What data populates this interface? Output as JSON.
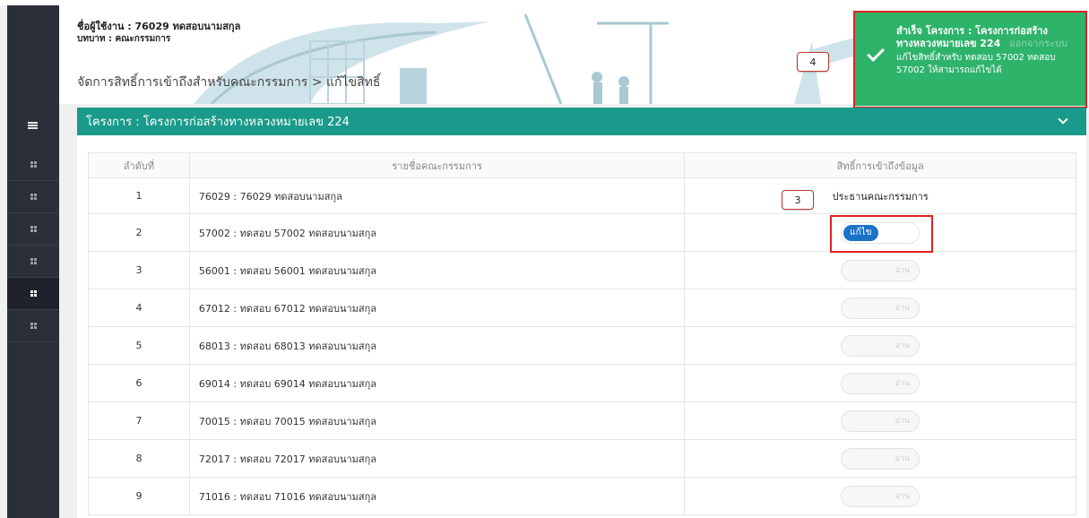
{
  "header": {
    "user_line": "ชื่อผู้ใช้งาน : 76029 ทดสอบนามสกุล",
    "role_line": "บทบาท : คณะกรรมการ",
    "breadcrumb": "จัดการสิทธิ์การเข้าถึงสำหรับคณะกรรมการ > แก้ไขสิทธิ์",
    "logout_label": "ออกจากระบบ"
  },
  "toast": {
    "title": "สำเร็จ โครงการ : โครงการก่อสร้างทางหลวงหมายเลข 224",
    "body": "แก้ไขสิทธิ์สำหรับ ทดสอบ 57002 ทดสอบ 57002 ให้สามารถแก้ไขได้",
    "color": "#2eb36b"
  },
  "callouts": {
    "toast": "4",
    "toggle": "3"
  },
  "panel": {
    "title": "โครงการ : โครงการก่อสร้างทางหลวงหมายเลข 224",
    "color": "#1a9a8a"
  },
  "table": {
    "headers": [
      "ลำดับที่",
      "รายชื่อคณะกรรมการ",
      "สิทธิ์การเข้าถึงข้อมูล"
    ],
    "rows": [
      {
        "idx": "1",
        "name": "76029 : 76029 ทดสอบนามสกุล",
        "role": "ประธานคณะกรรมการ"
      },
      {
        "idx": "2",
        "name": "57002 : ทดสอบ 57002 ทดสอบนามสกุล",
        "toggle": "แก้ไข",
        "state": "on"
      },
      {
        "idx": "3",
        "name": "56001 : ทดสอบ 56001 ทดสอบนามสกุล",
        "toggle": "อ่าน",
        "state": "off"
      },
      {
        "idx": "4",
        "name": "67012 : ทดสอบ 67012 ทดสอบนามสกุล",
        "toggle": "อ่าน",
        "state": "off"
      },
      {
        "idx": "5",
        "name": "68013 : ทดสอบ 68013 ทดสอบนามสกุล",
        "toggle": "อ่าน",
        "state": "off"
      },
      {
        "idx": "6",
        "name": "69014 : ทดสอบ 69014 ทดสอบนามสกุล",
        "toggle": "อ่าน",
        "state": "off"
      },
      {
        "idx": "7",
        "name": "70015 : ทดสอบ 70015 ทดสอบนามสกุล",
        "toggle": "อ่าน",
        "state": "off"
      },
      {
        "idx": "8",
        "name": "72017 : ทดสอบ 72017 ทดสอบนามสกุล",
        "toggle": "อ่าน",
        "state": "off"
      },
      {
        "idx": "9",
        "name": "71016 : ทดสอบ 71016 ทดสอบนามสกุล",
        "toggle": "อ่าน",
        "state": "off"
      }
    ]
  },
  "icons": {
    "menu": "hamburger-icon",
    "nav": "grid-icon",
    "toast": "check-icon",
    "collapse": "chevron-down-icon"
  },
  "colors": {
    "highlight": "#e02020",
    "toggle_on": "#1a73c7",
    "sidebar": "#2b2f3a"
  }
}
